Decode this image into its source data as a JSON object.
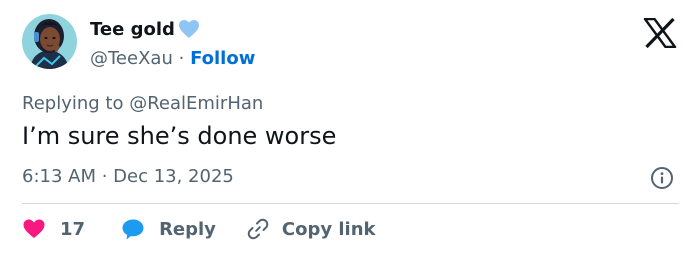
{
  "author": {
    "name": "Tee gold",
    "handle": "@TeeXau",
    "separator": "·",
    "follow_label": "Follow",
    "avatar_icon": "avatar-illustration",
    "badge_icon": "light-blue-heart-icon"
  },
  "brand": {
    "logo_icon": "x-logo-icon"
  },
  "tweet": {
    "reply_prefix": "Replying to",
    "reply_to": "@RealEmirHan",
    "text": "I’m sure she’s done worse",
    "timestamp": "6:13 AM · Dec 13, 2025"
  },
  "actions": {
    "like_count": "17",
    "reply_label": "Reply",
    "copy_label": "Copy link"
  },
  "colors": {
    "text": "#0f1419",
    "muted": "#536471",
    "link": "#006fd6",
    "like": "#f91880",
    "reply": "#1d9bf0",
    "badge": "#8fc5f4",
    "divider": "#cfd9de"
  }
}
